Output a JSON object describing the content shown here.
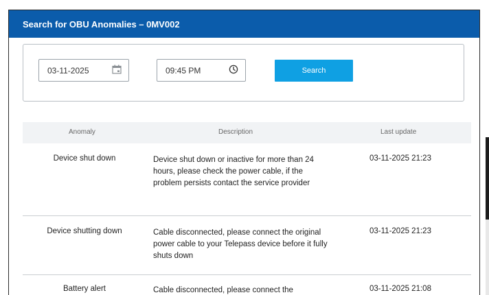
{
  "header": {
    "title": "Search for OBU Anomalies – 0MV002"
  },
  "filters": {
    "date_value": "03-11-2025",
    "time_value": "09:45 PM",
    "search_label": "Search"
  },
  "table": {
    "columns": [
      "Anomaly",
      "Description",
      "Last update"
    ],
    "rows": [
      {
        "anomaly": "Device shut down",
        "description": "Device shut down or inactive for more than 24 hours, please check the power cable, if the problem persists contact the service provider",
        "last_update": "03-11-2025 21:23"
      },
      {
        "anomaly": "Device shutting down",
        "description": "Cable disconnected, please connect the original power cable to your Telepass device before it fully shuts down",
        "last_update": "03-11-2025 21:23"
      },
      {
        "anomaly": "Battery alert",
        "description": "Cable disconnected, please connect the",
        "last_update": "03-11-2025 21:08"
      }
    ]
  }
}
